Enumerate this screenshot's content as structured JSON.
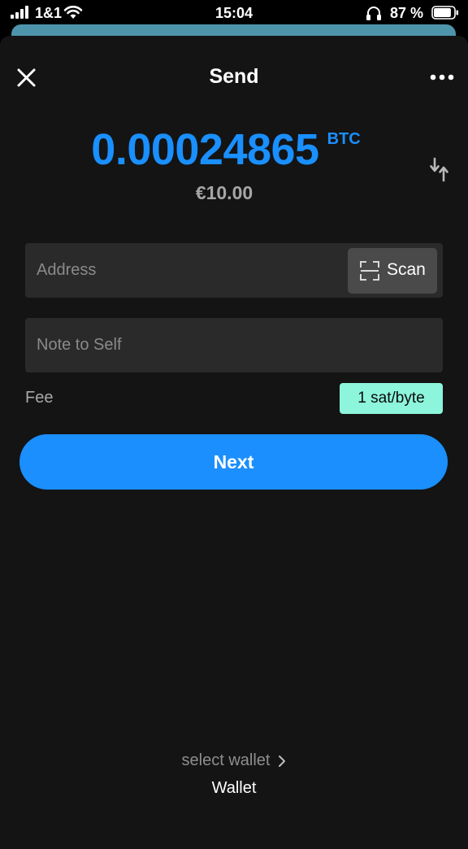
{
  "status_bar": {
    "carrier": "1&1",
    "time": "15:04",
    "battery_percent": "87 %",
    "battery_level": 0.87
  },
  "header": {
    "title": "Send",
    "close_icon": "close-icon",
    "more_icon": "more-options-icon"
  },
  "amount": {
    "value": "0.00024865",
    "unit": "BTC",
    "fiat": "€10.00",
    "swap_icon": "swap-arrows-icon"
  },
  "address": {
    "placeholder": "Address",
    "value": "",
    "scan_label": "Scan",
    "scan_icon": "qr-scan-icon"
  },
  "note": {
    "placeholder": "Note to Self",
    "value": ""
  },
  "fee": {
    "label": "Fee",
    "value": "1 sat/byte"
  },
  "next_label": "Next",
  "wallet": {
    "select_label": "select wallet",
    "name": "Wallet"
  },
  "colors": {
    "accent_blue": "#1b8ffe",
    "fee_badge": "#8df5db",
    "sheet_background": "#141414",
    "field_background": "#2a2a2a",
    "scan_button": "#4a4a4a",
    "peek_sheet": "#4e95ac"
  }
}
